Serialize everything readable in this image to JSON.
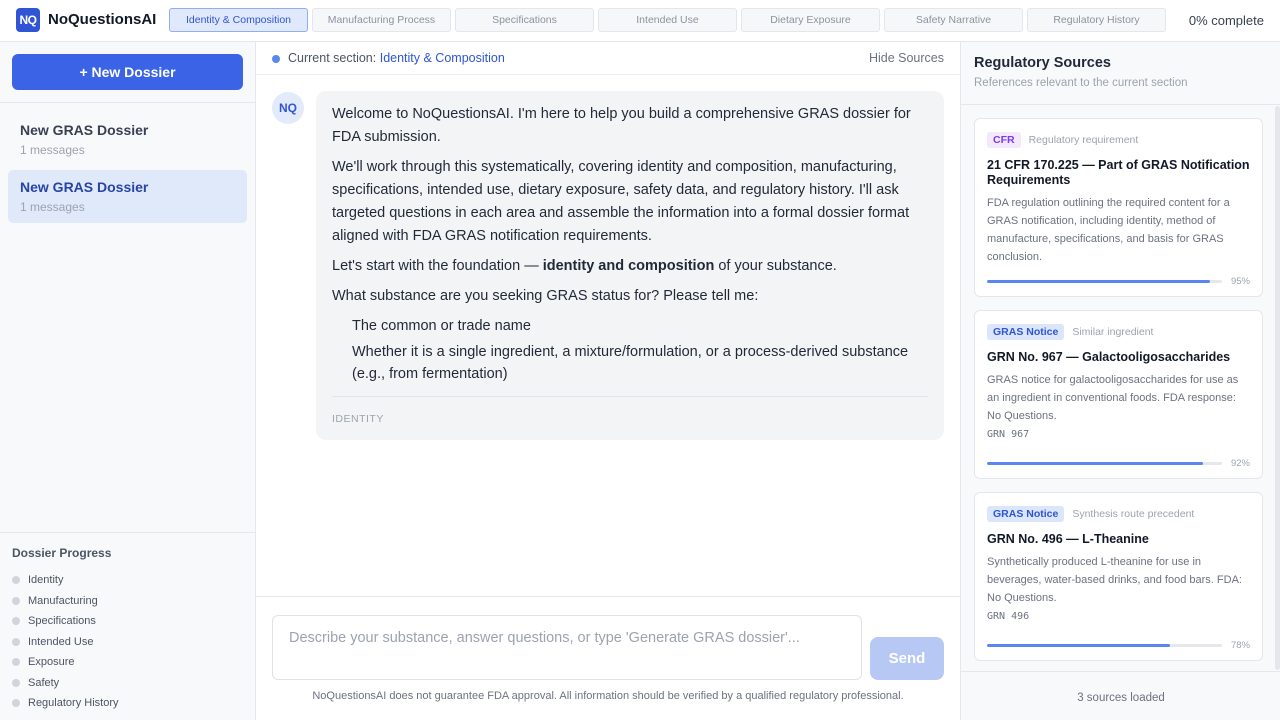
{
  "app": {
    "logo_text": "NQ",
    "name": "NoQuestionsAI",
    "progress": "0% complete",
    "accent_color": "#3b63e6"
  },
  "tabs": [
    {
      "label": "Identity & Composition",
      "active": true
    },
    {
      "label": "Manufacturing Process",
      "active": false
    },
    {
      "label": "Specifications",
      "active": false
    },
    {
      "label": "Intended Use",
      "active": false
    },
    {
      "label": "Dietary Exposure",
      "active": false
    },
    {
      "label": "Safety Narrative",
      "active": false
    },
    {
      "label": "Regulatory History",
      "active": false
    }
  ],
  "sidebar": {
    "new_button": "+ New Dossier",
    "dossiers": [
      {
        "title": "New GRAS Dossier",
        "meta": "1 messages",
        "active": false
      },
      {
        "title": "New GRAS Dossier",
        "meta": "1 messages",
        "active": true
      }
    ],
    "progress": {
      "title": "Dossier Progress",
      "items": [
        "Identity",
        "Manufacturing",
        "Specifications",
        "Intended Use",
        "Exposure",
        "Safety",
        "Regulatory History"
      ]
    }
  },
  "main": {
    "section_label": "Current section:",
    "section_value": "Identity & Composition",
    "hide_sources": "Hide Sources",
    "message": {
      "avatar": "NQ",
      "p1": "Welcome to NoQuestionsAI. I'm here to help you build a comprehensive GRAS dossier for FDA submission.",
      "p2": "We'll work through this systematically, covering identity and composition, manufacturing, specifications, intended use, dietary exposure, safety data, and regulatory history. I'll ask targeted questions in each area and assemble the information into a formal dossier format aligned with FDA GRAS notification requirements.",
      "p3_prefix": "Let's start with the foundation — ",
      "p3_bold": "identity and composition",
      "p3_suffix": " of your substance.",
      "p4": "What substance are you seeking GRAS status for? Please tell me:",
      "bullets": [
        "The common or trade name",
        "Whether it is a single ingredient, a mixture/formulation, or a process-derived substance (e.g., from fermentation)"
      ],
      "tag": "IDENTITY"
    },
    "input_placeholder": "Describe your substance, answer questions, or type 'Generate GRAS dossier'...",
    "send_label": "Send",
    "disclaimer": "NoQuestionsAI does not guarantee FDA approval. All information should be verified by a qualified regulatory professional."
  },
  "sources": {
    "title": "Regulatory Sources",
    "subtitle": "References relevant to the current section",
    "cards": [
      {
        "badge": "CFR",
        "kind": "Regulatory requirement",
        "title": "21 CFR 170.225 — Part of GRAS Notification Requirements",
        "description": "FDA regulation outlining the required content for a GRAS notification, including identity, method of manufacture, specifications, and basis for GRAS conclusion.",
        "code": "",
        "relevance": 0.95,
        "relevance_label": "95%"
      },
      {
        "badge": "GRAS Notice",
        "kind": "Similar ingredient",
        "title": "GRN No. 967 — Galactooligosaccharides",
        "description": "GRAS notice for galactooligosaccharides for use as an ingredient in conventional foods. FDA response: No Questions.",
        "code": "GRN 967",
        "relevance": 0.92,
        "relevance_label": "92%"
      },
      {
        "badge": "GRAS Notice",
        "kind": "Synthesis route precedent",
        "title": "GRN No. 496 — L-Theanine",
        "description": "Synthetically produced L-theanine for use in beverages, water-based drinks, and food bars. FDA: No Questions.",
        "code": "GRN 496",
        "relevance": 0.78,
        "relevance_label": "78%"
      }
    ],
    "footer": "3 sources loaded"
  }
}
